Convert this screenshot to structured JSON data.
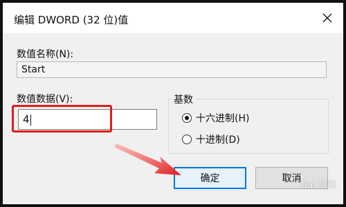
{
  "window": {
    "title": "编辑 DWORD (32 位)值",
    "close_icon": "close-icon"
  },
  "value_name": {
    "label": "数值名称(N):",
    "value": "Start"
  },
  "value_data": {
    "label": "数值数据(V):",
    "value": "4"
  },
  "radix": {
    "title": "基数",
    "options": [
      {
        "label": "十六进制(H)",
        "selected": true
      },
      {
        "label": "十进制(D)",
        "selected": false
      }
    ]
  },
  "buttons": {
    "ok_label": "确定",
    "cancel_label": "取消"
  },
  "annotations": {
    "highlight_color": "#e11b1b"
  },
  "watermark": {
    "text": "Bai 经验"
  }
}
